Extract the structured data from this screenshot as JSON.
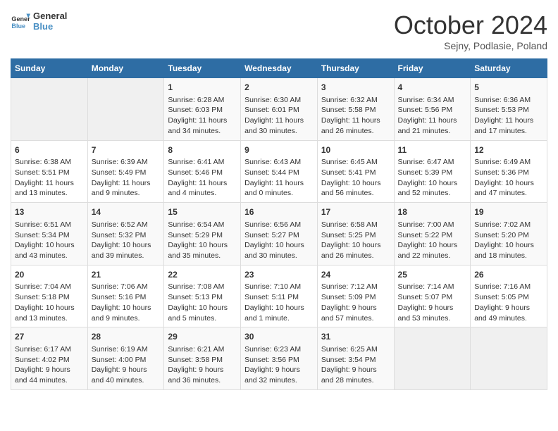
{
  "logo": {
    "line1": "General",
    "line2": "Blue"
  },
  "title": "October 2024",
  "subtitle": "Sejny, Podlasie, Poland",
  "header_days": [
    "Sunday",
    "Monday",
    "Tuesday",
    "Wednesday",
    "Thursday",
    "Friday",
    "Saturday"
  ],
  "weeks": [
    [
      {
        "day": "",
        "info": ""
      },
      {
        "day": "",
        "info": ""
      },
      {
        "day": "1",
        "info": "Sunrise: 6:28 AM\nSunset: 6:03 PM\nDaylight: 11 hours\nand 34 minutes."
      },
      {
        "day": "2",
        "info": "Sunrise: 6:30 AM\nSunset: 6:01 PM\nDaylight: 11 hours\nand 30 minutes."
      },
      {
        "day": "3",
        "info": "Sunrise: 6:32 AM\nSunset: 5:58 PM\nDaylight: 11 hours\nand 26 minutes."
      },
      {
        "day": "4",
        "info": "Sunrise: 6:34 AM\nSunset: 5:56 PM\nDaylight: 11 hours\nand 21 minutes."
      },
      {
        "day": "5",
        "info": "Sunrise: 6:36 AM\nSunset: 5:53 PM\nDaylight: 11 hours\nand 17 minutes."
      }
    ],
    [
      {
        "day": "6",
        "info": "Sunrise: 6:38 AM\nSunset: 5:51 PM\nDaylight: 11 hours\nand 13 minutes."
      },
      {
        "day": "7",
        "info": "Sunrise: 6:39 AM\nSunset: 5:49 PM\nDaylight: 11 hours\nand 9 minutes."
      },
      {
        "day": "8",
        "info": "Sunrise: 6:41 AM\nSunset: 5:46 PM\nDaylight: 11 hours\nand 4 minutes."
      },
      {
        "day": "9",
        "info": "Sunrise: 6:43 AM\nSunset: 5:44 PM\nDaylight: 11 hours\nand 0 minutes."
      },
      {
        "day": "10",
        "info": "Sunrise: 6:45 AM\nSunset: 5:41 PM\nDaylight: 10 hours\nand 56 minutes."
      },
      {
        "day": "11",
        "info": "Sunrise: 6:47 AM\nSunset: 5:39 PM\nDaylight: 10 hours\nand 52 minutes."
      },
      {
        "day": "12",
        "info": "Sunrise: 6:49 AM\nSunset: 5:36 PM\nDaylight: 10 hours\nand 47 minutes."
      }
    ],
    [
      {
        "day": "13",
        "info": "Sunrise: 6:51 AM\nSunset: 5:34 PM\nDaylight: 10 hours\nand 43 minutes."
      },
      {
        "day": "14",
        "info": "Sunrise: 6:52 AM\nSunset: 5:32 PM\nDaylight: 10 hours\nand 39 minutes."
      },
      {
        "day": "15",
        "info": "Sunrise: 6:54 AM\nSunset: 5:29 PM\nDaylight: 10 hours\nand 35 minutes."
      },
      {
        "day": "16",
        "info": "Sunrise: 6:56 AM\nSunset: 5:27 PM\nDaylight: 10 hours\nand 30 minutes."
      },
      {
        "day": "17",
        "info": "Sunrise: 6:58 AM\nSunset: 5:25 PM\nDaylight: 10 hours\nand 26 minutes."
      },
      {
        "day": "18",
        "info": "Sunrise: 7:00 AM\nSunset: 5:22 PM\nDaylight: 10 hours\nand 22 minutes."
      },
      {
        "day": "19",
        "info": "Sunrise: 7:02 AM\nSunset: 5:20 PM\nDaylight: 10 hours\nand 18 minutes."
      }
    ],
    [
      {
        "day": "20",
        "info": "Sunrise: 7:04 AM\nSunset: 5:18 PM\nDaylight: 10 hours\nand 13 minutes."
      },
      {
        "day": "21",
        "info": "Sunrise: 7:06 AM\nSunset: 5:16 PM\nDaylight: 10 hours\nand 9 minutes."
      },
      {
        "day": "22",
        "info": "Sunrise: 7:08 AM\nSunset: 5:13 PM\nDaylight: 10 hours\nand 5 minutes."
      },
      {
        "day": "23",
        "info": "Sunrise: 7:10 AM\nSunset: 5:11 PM\nDaylight: 10 hours\nand 1 minute."
      },
      {
        "day": "24",
        "info": "Sunrise: 7:12 AM\nSunset: 5:09 PM\nDaylight: 9 hours\nand 57 minutes."
      },
      {
        "day": "25",
        "info": "Sunrise: 7:14 AM\nSunset: 5:07 PM\nDaylight: 9 hours\nand 53 minutes."
      },
      {
        "day": "26",
        "info": "Sunrise: 7:16 AM\nSunset: 5:05 PM\nDaylight: 9 hours\nand 49 minutes."
      }
    ],
    [
      {
        "day": "27",
        "info": "Sunrise: 6:17 AM\nSunset: 4:02 PM\nDaylight: 9 hours\nand 44 minutes."
      },
      {
        "day": "28",
        "info": "Sunrise: 6:19 AM\nSunset: 4:00 PM\nDaylight: 9 hours\nand 40 minutes."
      },
      {
        "day": "29",
        "info": "Sunrise: 6:21 AM\nSunset: 3:58 PM\nDaylight: 9 hours\nand 36 minutes."
      },
      {
        "day": "30",
        "info": "Sunrise: 6:23 AM\nSunset: 3:56 PM\nDaylight: 9 hours\nand 32 minutes."
      },
      {
        "day": "31",
        "info": "Sunrise: 6:25 AM\nSunset: 3:54 PM\nDaylight: 9 hours\nand 28 minutes."
      },
      {
        "day": "",
        "info": ""
      },
      {
        "day": "",
        "info": ""
      }
    ]
  ]
}
